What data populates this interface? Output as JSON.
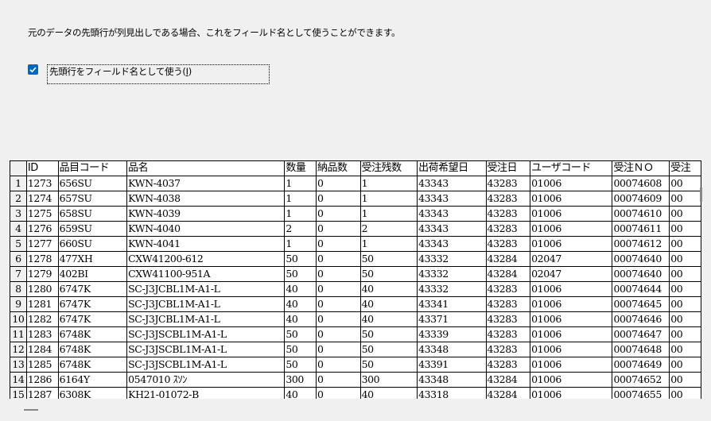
{
  "description": "元のデータの先頭行が列見出しである場合、これをフィールド名として使うことができます。",
  "checkbox": {
    "label_prefix": "先頭行をフィールド名として使う(",
    "label_key": "I",
    "label_suffix": ")",
    "checked": true
  },
  "colors": {
    "checkbox": "#0067c0",
    "grid_line": "#000000"
  },
  "grid": {
    "headers": [
      "ID",
      "品目コード",
      "品名",
      "数量",
      "納品数",
      "受注残数",
      "出荷希望日",
      "受注日",
      "ユーザコード",
      "受注ＮＯ",
      "受注"
    ],
    "rows": [
      [
        "1",
        "1273",
        "656SU",
        "KWN-4037",
        "1",
        "0",
        "1",
        "43343",
        "43283",
        "01006",
        "00074608",
        "00"
      ],
      [
        "2",
        "1274",
        "657SU",
        "KWN-4038",
        "1",
        "0",
        "1",
        "43343",
        "43283",
        "01006",
        "00074609",
        "00"
      ],
      [
        "3",
        "1275",
        "658SU",
        "KWN-4039",
        "1",
        "0",
        "1",
        "43343",
        "43283",
        "01006",
        "00074610",
        "00"
      ],
      [
        "4",
        "1276",
        "659SU",
        "KWN-4040",
        "2",
        "0",
        "2",
        "43343",
        "43283",
        "01006",
        "00074611",
        "00"
      ],
      [
        "5",
        "1277",
        "660SU",
        "KWN-4041",
        "1",
        "0",
        "1",
        "43343",
        "43283",
        "01006",
        "00074612",
        "00"
      ],
      [
        "6",
        "1278",
        "477XH",
        "CXW41200-612",
        "50",
        "0",
        "50",
        "43332",
        "43284",
        "02047",
        "00074640",
        "00"
      ],
      [
        "7",
        "1279",
        "402BI",
        "CXW41100-951A",
        "50",
        "0",
        "50",
        "43332",
        "43284",
        "02047",
        "00074640",
        "00"
      ],
      [
        "8",
        "1280",
        "6747K",
        "SC-J3JCBL1M-A1-L",
        "40",
        "0",
        "40",
        "43332",
        "43283",
        "01006",
        "00074644",
        "00"
      ],
      [
        "9",
        "1281",
        "6747K",
        "SC-J3JCBL1M-A1-L",
        "40",
        "0",
        "40",
        "43341",
        "43283",
        "01006",
        "00074645",
        "00"
      ],
      [
        "10",
        "1282",
        "6747K",
        "SC-J3JCBL1M-A1-L",
        "40",
        "0",
        "40",
        "43371",
        "43283",
        "01006",
        "00074646",
        "00"
      ],
      [
        "11",
        "1283",
        "6748K",
        "SC-J3JSCBL1M-A1-L",
        "50",
        "0",
        "50",
        "43339",
        "43283",
        "01006",
        "00074647",
        "00"
      ],
      [
        "12",
        "1284",
        "6748K",
        "SC-J3JSCBL1M-A1-L",
        "50",
        "0",
        "50",
        "43348",
        "43283",
        "01006",
        "00074648",
        "00"
      ],
      [
        "13",
        "1285",
        "6748K",
        "SC-J3JSCBL1M-A1-L",
        "50",
        "0",
        "50",
        "43391",
        "43283",
        "01006",
        "00074649",
        "00"
      ],
      [
        "14",
        "1286",
        "6164Y",
        "0547010 ｽｿﾝ",
        "300",
        "0",
        "300",
        "43348",
        "43284",
        "01006",
        "00074652",
        "00"
      ],
      [
        "15",
        "1287",
        "6308K",
        "KH21-01072-B",
        "40",
        "0",
        "40",
        "43318",
        "43284",
        "01006",
        "00074655",
        "00"
      ]
    ]
  }
}
